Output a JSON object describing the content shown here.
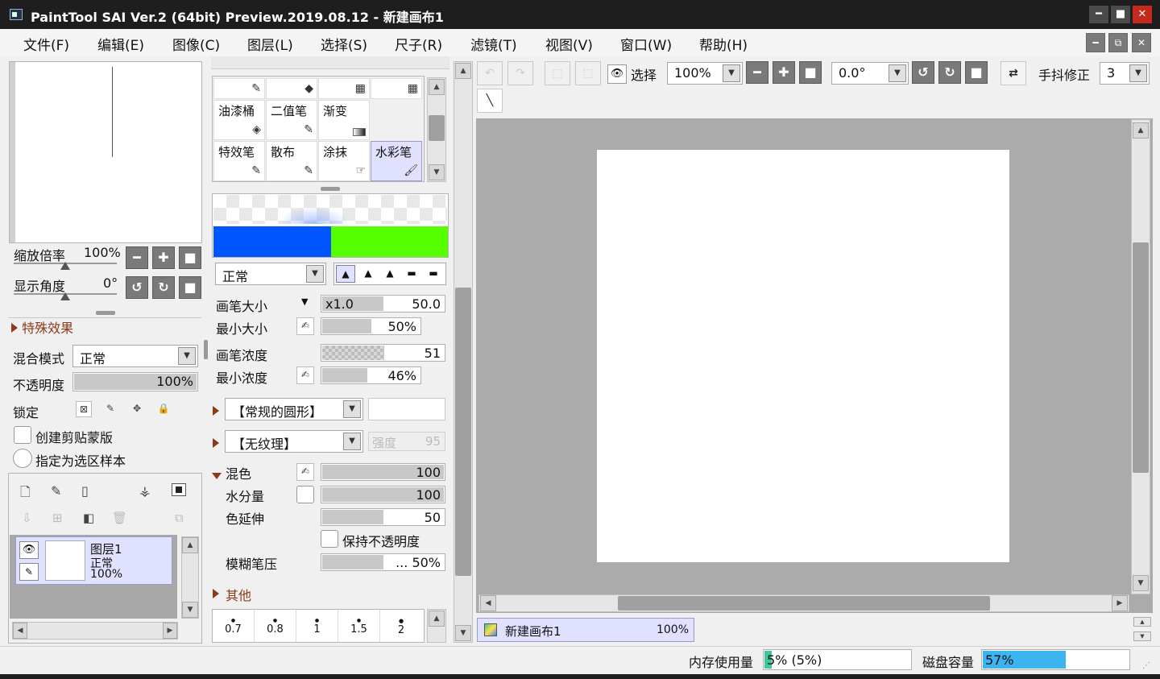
{
  "window": {
    "title": "PaintTool SAI Ver.2 (64bit) Preview.2019.08.12 - 新建画布1",
    "minimize": "━",
    "maximize": "■",
    "close": "✕",
    "restore": "⧉"
  },
  "menu": {
    "items": [
      "文件(F)",
      "编辑(E)",
      "图像(C)",
      "图层(L)",
      "选择(S)",
      "尺子(R)",
      "滤镜(T)",
      "视图(V)",
      "窗口(W)",
      "帮助(H)"
    ]
  },
  "navigator": {
    "zoom_label": "缩放倍率",
    "zoom_value": "100%",
    "angle_label": "显示角度",
    "angle_value": "0°"
  },
  "special_effects": {
    "label": "特殊效果"
  },
  "layer_props": {
    "blend_label": "混合模式",
    "blend_value": "正常",
    "opacity_label": "不透明度",
    "opacity_value": "100%",
    "opacity_level": 100,
    "lock_label": "锁定",
    "clip_label": "创建剪贴蒙版",
    "sample_label": "指定为选区样本"
  },
  "layers": [
    {
      "name": "图层1",
      "mode": "正常",
      "opacity": "100%"
    }
  ],
  "tools": {
    "cells": [
      {
        "name": "",
        "icon": "✎"
      },
      {
        "name": "",
        "icon": "◆"
      },
      {
        "name": "",
        "icon": "▦"
      },
      {
        "name": "",
        "icon": "▦"
      },
      {
        "name": "油漆桶",
        "icon": "◈"
      },
      {
        "name": "二值笔",
        "icon": "✎"
      },
      {
        "name": "渐变",
        "icon": "▬"
      },
      {
        "name": "",
        "icon": ""
      },
      {
        "name": "特效笔",
        "icon": "✎"
      },
      {
        "name": "散布",
        "icon": "✎"
      },
      {
        "name": "涂抹",
        "icon": "☞"
      },
      {
        "name": "水彩笔",
        "icon": "🖌"
      }
    ]
  },
  "brush": {
    "mode_value": "正常",
    "size_label": "画笔大小",
    "size_mult": "x1.0",
    "size_value": "50.0",
    "min_size_label": "最小大小",
    "min_size_value": "50%",
    "min_size_level": 50,
    "density_label": "画笔浓度",
    "density_value": "51",
    "density_level": 51,
    "min_density_label": "最小浓度",
    "min_density_value": "46%",
    "min_density_level": 46,
    "shape_value": "【常规的圆形】",
    "texture_value": "【无纹理】",
    "strength_label": "强度",
    "strength_value": "95",
    "mix_label": "混色",
    "mix_value": "100",
    "mix_level": 100,
    "water_label": "水分量",
    "water_value": "100",
    "water_level": 100,
    "extend_label": "色延伸",
    "extend_value": "50",
    "extend_level": 50,
    "keep_opacity_label": "保持不透明度",
    "blur_label": "模糊笔压",
    "blur_value": "... 50%",
    "blur_level": 50,
    "other_label": "其他",
    "sizes": [
      "0.7",
      "0.8",
      "1",
      "1.5",
      "2"
    ]
  },
  "toolbar": {
    "select_label": "选择",
    "zoom_value": "100%",
    "angle_value": "0.0°",
    "stabilizer_label": "手抖修正",
    "stabilizer_value": "3"
  },
  "canvas_tab": {
    "name": "新建画布1",
    "zoom": "100%"
  },
  "status": {
    "memory_label": "内存使用量",
    "memory_value": "5% (5%)",
    "memory_level": 5,
    "disk_label": "磁盘容量",
    "disk_value": "57%",
    "disk_level": 57
  },
  "colors": {
    "blue": "#0055ff",
    "green": "#55ff00",
    "accent": "#3cb4f0",
    "selected": "#e0e0ff"
  }
}
